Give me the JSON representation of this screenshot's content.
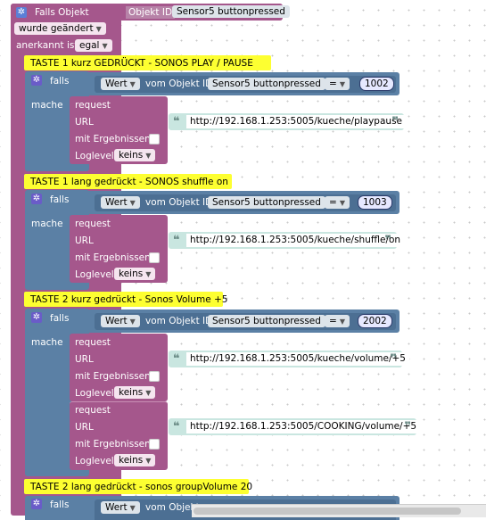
{
  "header": {
    "falls_objekt": "Falls Objekt",
    "objekt_id_label": "Objekt ID",
    "objekt_id_value": "Sensor5 buttonpressed",
    "wurde_geaendert": "wurde geändert",
    "anerkannt_ist": "anerkannt ist",
    "anerkannt_value": "egal"
  },
  "sections": [
    {
      "comment": "TASTE 1  kurz GEDRÜCKT - SONOS PLAY / PAUSE",
      "falls": "falls",
      "wert": "Wert",
      "vom_objekt_id": "vom Objekt ID",
      "objekt": "Sensor5 buttonpressed",
      "op": "=",
      "value": "1002",
      "mache": "mache",
      "requests": [
        {
          "request": "request",
          "url_label": "URL",
          "url": "http://192.168.1.253:5005/kueche/playpause",
          "mit": "mit Ergebnissen",
          "loglevel": "Loglevel",
          "loglevel_value": "keins"
        }
      ]
    },
    {
      "comment": "TASTE 1  lang gedrückt - SONOS shuffle on",
      "falls": "falls",
      "wert": "Wert",
      "vom_objekt_id": "vom Objekt ID",
      "objekt": "Sensor5 buttonpressed",
      "op": "=",
      "value": "1003",
      "mache": "mache",
      "requests": [
        {
          "request": "request",
          "url_label": "URL",
          "url": "http://192.168.1.253:5005/kueche/shuffle/on",
          "mit": "mit Ergebnissen",
          "loglevel": "Loglevel",
          "loglevel_value": "keins"
        }
      ]
    },
    {
      "comment": "TASTE 2 kurz gedrückt - Sonos Volume +5",
      "falls": "falls",
      "wert": "Wert",
      "vom_objekt_id": "vom Objekt ID",
      "objekt": "Sensor5 buttonpressed",
      "op": "=",
      "value": "2002",
      "mache": "mache",
      "requests": [
        {
          "request": "request",
          "url_label": "URL",
          "url": "http://192.168.1.253:5005/kueche/volume/+5",
          "mit": "mit Ergebnissen",
          "loglevel": "Loglevel",
          "loglevel_value": "keins"
        },
        {
          "request": "request",
          "url_label": "URL",
          "url": "http://192.168.1.253:5005/COOKING/volume/+5",
          "mit": "mit Ergebnissen",
          "loglevel": "Loglevel",
          "loglevel_value": "keins"
        }
      ]
    },
    {
      "comment": "TASTE 2 lang gedrückt -  sonos groupVolume 20",
      "falls": "falls",
      "wert": "Wert",
      "vom_objekt_id": "vom Objekt"
    }
  ],
  "icons": {
    "gear": "gear-icon",
    "dropdown": "chevron-down-icon",
    "quote": "quote-icon"
  },
  "colors": {
    "event_block": "#a5578c",
    "logic_block": "#5b80a5",
    "comment": "#fdff31",
    "string": "#c9e6e0"
  }
}
